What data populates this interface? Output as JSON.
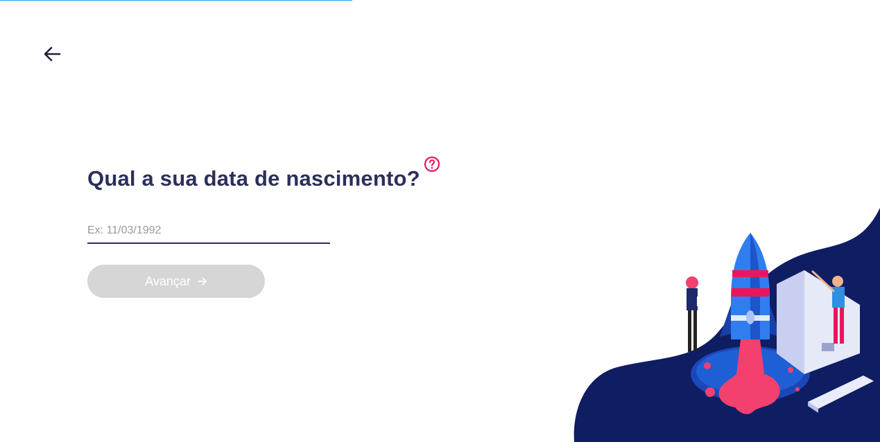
{
  "progress": {
    "value_fraction": 0.4
  },
  "nav": {
    "back_icon": "arrow-left-icon"
  },
  "question": {
    "title": "Qual a sua data de nascimento?",
    "help_icon": "question-circle-icon"
  },
  "birth_date": {
    "value": "",
    "placeholder": "Ex: 11/03/1992"
  },
  "advance": {
    "label": "Avançar",
    "icon": "arrow-right-icon",
    "enabled": false
  },
  "colors": {
    "primary_text": "#2b2f5b",
    "accent_pink": "#e8175d",
    "progress": "#1fa3dc",
    "disabled_button": "#d6d6d6",
    "illustration_navy": "#0f1d63"
  }
}
